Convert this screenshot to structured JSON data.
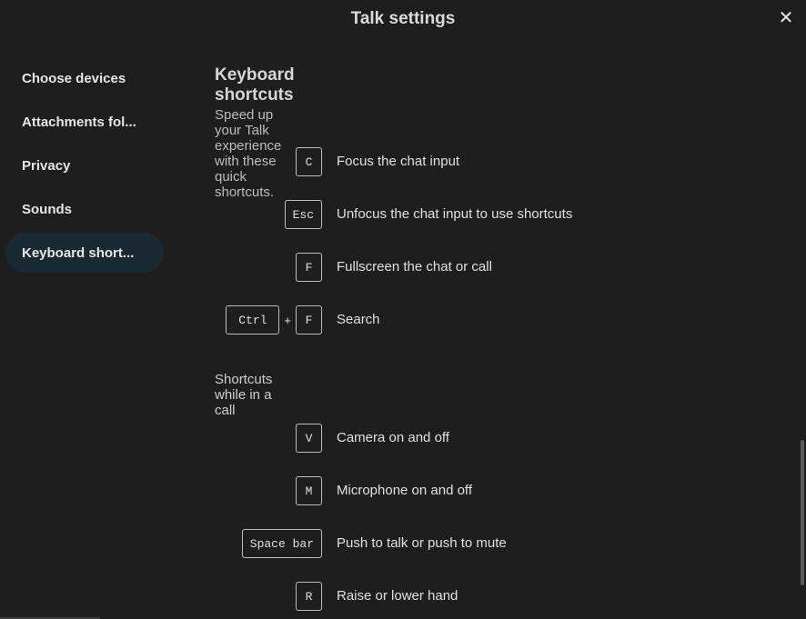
{
  "dialog": {
    "title": "Talk settings",
    "close_label": "✕"
  },
  "sidebar": {
    "items": [
      {
        "label": "Choose devices",
        "active": false
      },
      {
        "label": "Attachments fol...",
        "active": false
      },
      {
        "label": "Privacy",
        "active": false
      },
      {
        "label": "Sounds",
        "active": false
      },
      {
        "label": "Keyboard short...",
        "active": true
      }
    ]
  },
  "section": {
    "heading": "Keyboard shortcuts",
    "description": "Speed up your Talk experience with these quick shortcuts.",
    "call_heading": "Shortcuts while in a call"
  },
  "shortcuts": [
    {
      "keys": [
        "C"
      ],
      "label": "Focus the chat input"
    },
    {
      "keys": [
        "Esc"
      ],
      "label": "Unfocus the chat input to use shortcuts"
    },
    {
      "keys": [
        "F"
      ],
      "label": "Fullscreen the chat or call"
    },
    {
      "keys": [
        "Ctrl",
        "F"
      ],
      "label": "Search",
      "separator": "+"
    }
  ],
  "call_shortcuts": [
    {
      "keys": [
        "V"
      ],
      "label": "Camera on and off"
    },
    {
      "keys": [
        "M"
      ],
      "label": "Microphone on and off"
    },
    {
      "keys": [
        "Space bar"
      ],
      "label": "Push to talk or push to mute"
    },
    {
      "keys": [
        "R"
      ],
      "label": "Raise or lower hand"
    }
  ],
  "colors": {
    "background": "#1e1e1e",
    "active_nav": "#1a2a33",
    "text": "#e0e0e0"
  }
}
